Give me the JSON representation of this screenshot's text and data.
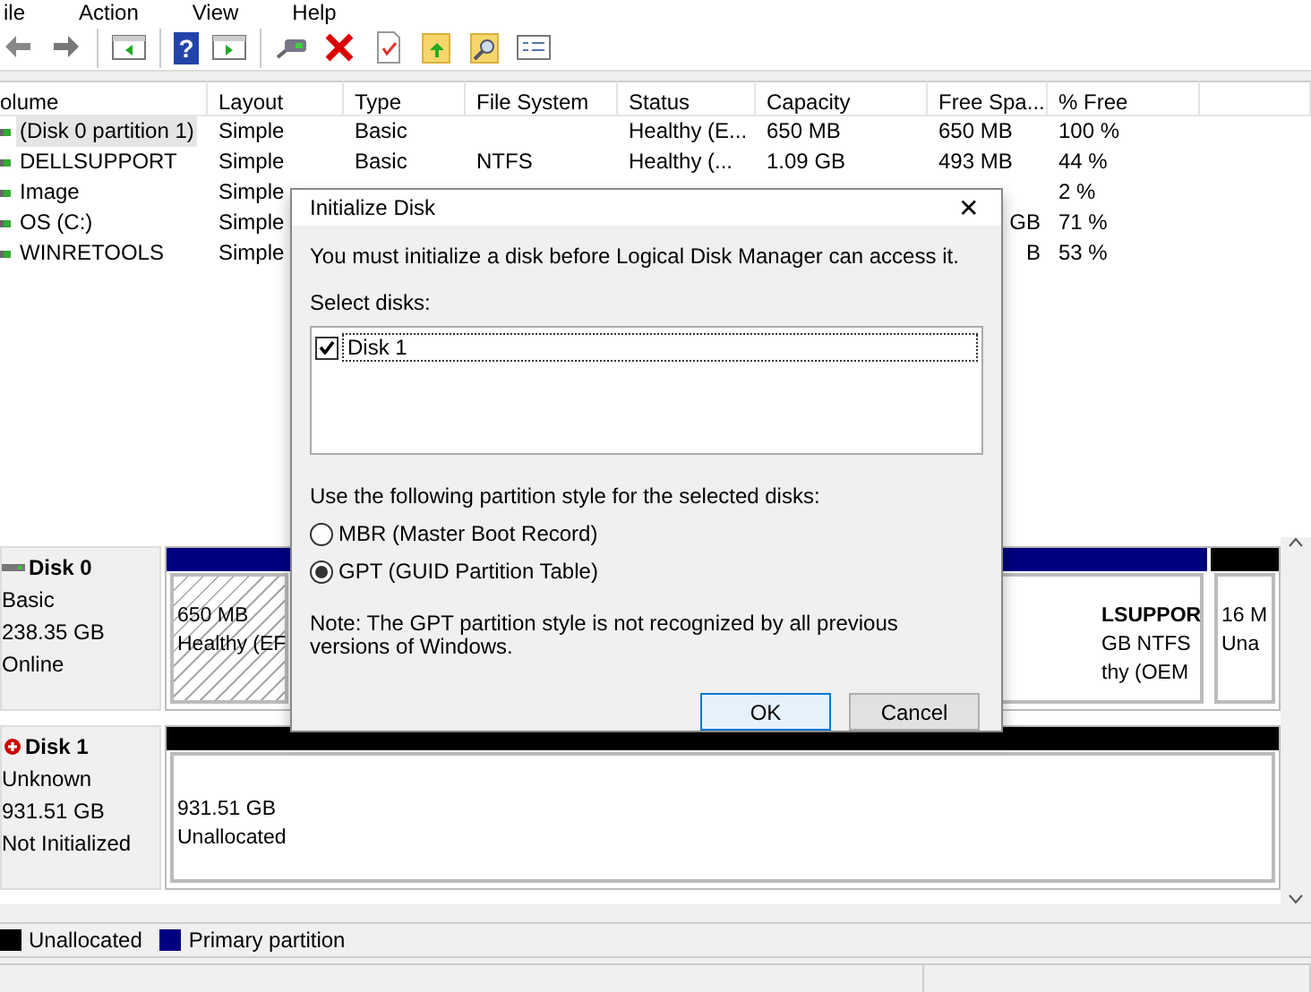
{
  "menu": [
    "ile",
    "Action",
    "View",
    "Help"
  ],
  "toolbar": {
    "help_glyph": "?"
  },
  "table": {
    "columns": [
      "olume",
      "Layout",
      "Type",
      "File System",
      "Status",
      "Capacity",
      "Free Spa...",
      "% Free"
    ],
    "rows": [
      {
        "selected": true,
        "cells": [
          "(Disk 0 partition 1)",
          "Simple",
          "Basic",
          "",
          "Healthy (E...",
          "650 MB",
          "650 MB",
          "100 %"
        ]
      },
      {
        "selected": false,
        "cells": [
          "DELLSUPPORT",
          "Simple",
          "Basic",
          "NTFS",
          "Healthy (...",
          "1.09 GB",
          "493 MB",
          "44 %"
        ]
      },
      {
        "selected": false,
        "cells": [
          "Image",
          "Simple",
          "",
          "",
          "",
          "",
          "",
          "2 %"
        ]
      },
      {
        "selected": false,
        "covered": true,
        "cells": [
          "OS (C:)",
          "Simple",
          "",
          "",
          "",
          "",
          "GB",
          "71 %"
        ]
      },
      {
        "selected": false,
        "covered": true,
        "cells": [
          "WINRETOOLS",
          "Simple",
          "",
          "",
          "",
          "",
          "B",
          "53 %"
        ]
      }
    ]
  },
  "disks": [
    {
      "name": "Disk 0",
      "error": false,
      "lines": [
        "Basic",
        "238.35 GB",
        "Online"
      ],
      "partitions": [
        {
          "kind": "efi",
          "lines": [
            "650 MB",
            "Healthy (EF"
          ]
        },
        {
          "kind": "primary",
          "title": "LSUPPOR",
          "lines": [
            "GB NTFS",
            "thy (OEM"
          ]
        },
        {
          "kind": "unallocated",
          "lines": [
            "16 M",
            "Una"
          ]
        }
      ]
    },
    {
      "name": "Disk 1",
      "error": true,
      "lines": [
        "Unknown",
        "931.51 GB",
        "Not Initialized"
      ],
      "partitions": [
        {
          "kind": "unallocated_full",
          "lines": [
            "931.51 GB",
            "Unallocated"
          ]
        }
      ]
    }
  ],
  "legend": [
    {
      "label": "Unallocated",
      "color": "#000000"
    },
    {
      "label": "Primary partition",
      "color": "#000080"
    }
  ],
  "dialog": {
    "title": "Initialize Disk",
    "close": "✕",
    "message": "You must initialize a disk before Logical Disk Manager can access it.",
    "select_label": "Select disks:",
    "disks": [
      {
        "label": "Disk 1",
        "checked": true
      }
    ],
    "style_label": "Use the following partition style for the selected disks:",
    "styles": [
      {
        "label": "MBR (Master Boot Record)",
        "selected": false
      },
      {
        "label": "GPT (GUID Partition Table)",
        "selected": true
      }
    ],
    "note": "Note: The GPT partition style is not recognized by all previous versions of Windows.",
    "buttons": [
      {
        "label": "OK",
        "default": true
      },
      {
        "label": "Cancel",
        "default": false
      }
    ]
  }
}
